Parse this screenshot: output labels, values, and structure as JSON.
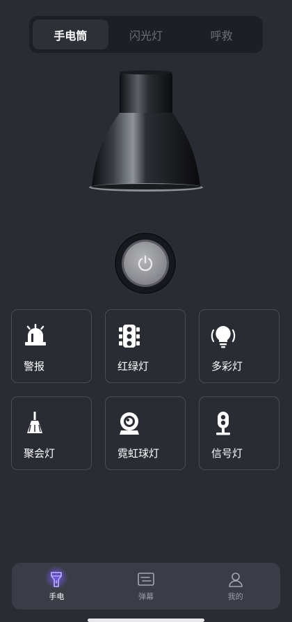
{
  "tabs": [
    {
      "label": "手电筒",
      "active": true
    },
    {
      "label": "闪光灯",
      "active": false
    },
    {
      "label": "呼救",
      "active": false
    }
  ],
  "power": {
    "icon": "power-icon"
  },
  "modes": [
    {
      "label": "警报",
      "icon": "siren-icon"
    },
    {
      "label": "红绿灯",
      "icon": "traffic-light-icon"
    },
    {
      "label": "多彩灯",
      "icon": "light-bulb-icon"
    },
    {
      "label": "聚会灯",
      "icon": "party-light-icon"
    },
    {
      "label": "霓虹球灯",
      "icon": "neon-ball-icon"
    },
    {
      "label": "信号灯",
      "icon": "signal-light-icon"
    }
  ],
  "nav": [
    {
      "label": "手电",
      "icon": "flashlight-icon",
      "active": true
    },
    {
      "label": "弹幕",
      "icon": "barrage-icon",
      "active": false
    },
    {
      "label": "我的",
      "icon": "profile-icon",
      "active": false
    }
  ],
  "colors": {
    "background": "#2a2c34",
    "accent": "#7b5cff"
  }
}
